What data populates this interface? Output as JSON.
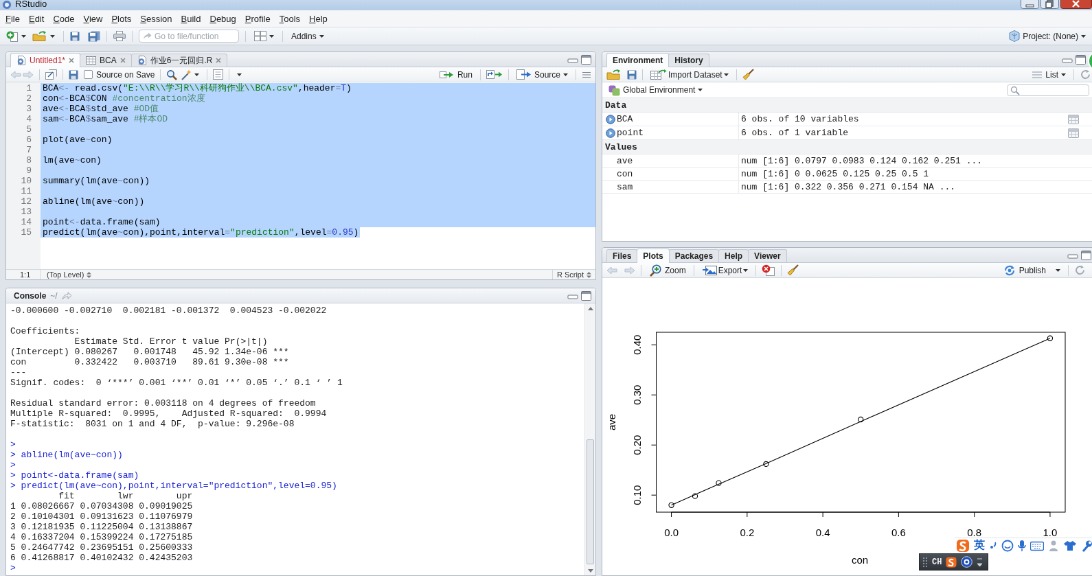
{
  "window": {
    "title": "RStudio"
  },
  "menu": [
    "File",
    "Edit",
    "Code",
    "View",
    "Plots",
    "Session",
    "Build",
    "Debug",
    "Profile",
    "Tools",
    "Help"
  ],
  "toolbar": {
    "goto": {
      "placeholder": "Go to file/function"
    },
    "addins": "Addins",
    "project": "Project: (None)"
  },
  "editor": {
    "tabs": [
      {
        "label": "Untitled1*",
        "kind": "script",
        "selected": true,
        "modified": true
      },
      {
        "label": "BCA",
        "kind": "data",
        "selected": false,
        "modified": false
      },
      {
        "label": "作业6一元回归.R",
        "kind": "script",
        "selected": false,
        "modified": false
      }
    ],
    "source_on_save": {
      "label": "Source on Save",
      "checked": false
    },
    "run": "Run",
    "source": "Source",
    "lines": [
      {
        "number": "1",
        "selected": true,
        "tokens": [
          {
            "text": "BCA",
            "kind": "id"
          },
          {
            "text": "<-",
            "kind": "op"
          },
          {
            "text": " read.csv(",
            "kind": "id"
          },
          {
            "text": "\"E:\\\\R\\\\学习R\\\\科研狗作业\\\\BCA.csv\"",
            "kind": "str"
          },
          {
            "text": ",header",
            "kind": "id"
          },
          {
            "text": "=",
            "kind": "op"
          },
          {
            "text": "T",
            "kind": "num"
          },
          {
            "text": ")",
            "kind": "id"
          }
        ]
      },
      {
        "number": "2",
        "selected": true,
        "tokens": [
          {
            "text": "con",
            "kind": "id"
          },
          {
            "text": "<-",
            "kind": "op"
          },
          {
            "text": "BCA",
            "kind": "id"
          },
          {
            "text": "$",
            "kind": "op"
          },
          {
            "text": "CON ",
            "kind": "id"
          },
          {
            "text": "#concentration浓度",
            "kind": "com"
          }
        ]
      },
      {
        "number": "3",
        "selected": true,
        "tokens": [
          {
            "text": "ave",
            "kind": "id"
          },
          {
            "text": "<-",
            "kind": "op"
          },
          {
            "text": "BCA",
            "kind": "id"
          },
          {
            "text": "$",
            "kind": "op"
          },
          {
            "text": "std_ave ",
            "kind": "id"
          },
          {
            "text": "#OD值",
            "kind": "com"
          }
        ]
      },
      {
        "number": "4",
        "selected": true,
        "tokens": [
          {
            "text": "sam",
            "kind": "id"
          },
          {
            "text": "<-",
            "kind": "op"
          },
          {
            "text": "BCA",
            "kind": "id"
          },
          {
            "text": "$",
            "kind": "op"
          },
          {
            "text": "sam_ave ",
            "kind": "id"
          },
          {
            "text": "#样本OD",
            "kind": "com"
          }
        ]
      },
      {
        "number": "5",
        "selected": true
      },
      {
        "number": "6",
        "selected": true,
        "tokens": [
          {
            "text": "plot(ave",
            "kind": "id"
          },
          {
            "text": "~",
            "kind": "op"
          },
          {
            "text": "con)",
            "kind": "id"
          }
        ]
      },
      {
        "number": "7",
        "selected": true
      },
      {
        "number": "8",
        "selected": true,
        "tokens": [
          {
            "text": "lm(ave",
            "kind": "id"
          },
          {
            "text": "~",
            "kind": "op"
          },
          {
            "text": "con)",
            "kind": "id"
          }
        ]
      },
      {
        "number": "9",
        "selected": true
      },
      {
        "number": "10",
        "selected": true,
        "tokens": [
          {
            "text": "summary(lm(ave",
            "kind": "id"
          },
          {
            "text": "~",
            "kind": "op"
          },
          {
            "text": "con))",
            "kind": "id"
          }
        ]
      },
      {
        "number": "11",
        "selected": true
      },
      {
        "number": "12",
        "selected": true,
        "tokens": [
          {
            "text": "abline(lm(ave",
            "kind": "id"
          },
          {
            "text": "~",
            "kind": "op"
          },
          {
            "text": "con))",
            "kind": "id"
          }
        ]
      },
      {
        "number": "13",
        "selected": true
      },
      {
        "number": "14",
        "selected": true,
        "tokens": [
          {
            "text": "point",
            "kind": "id"
          },
          {
            "text": "<-",
            "kind": "op"
          },
          {
            "text": "data.frame(sam)",
            "kind": "id"
          }
        ]
      },
      {
        "number": "15",
        "selected": true,
        "tokens": [
          {
            "text": "predict(lm(ave",
            "kind": "id"
          },
          {
            "text": "~",
            "kind": "op"
          },
          {
            "text": "con),point,interval",
            "kind": "id"
          },
          {
            "text": "=",
            "kind": "op"
          },
          {
            "text": "\"prediction\"",
            "kind": "str"
          },
          {
            "text": ",level",
            "kind": "id"
          },
          {
            "text": "=",
            "kind": "op"
          },
          {
            "text": "0.95",
            "kind": "num"
          },
          {
            "text": ")",
            "kind": "id"
          }
        ]
      }
    ],
    "status": {
      "position": "1:1",
      "scope": "(Top Level)",
      "file_type": "R Script"
    }
  },
  "console": {
    "title": "Console",
    "path": "~/",
    "lines": [
      {
        "kind": "output",
        "text": "-0.000600 -0.002710  0.002181 -0.001372  0.004523 -0.002022"
      },
      {
        "kind": "blank"
      },
      {
        "kind": "output",
        "text": "Coefficients:"
      },
      {
        "kind": "output",
        "text": "            Estimate Std. Error t value Pr(>|t|)"
      },
      {
        "kind": "output",
        "text": "(Intercept) 0.080267   0.001748   45.92 1.34e-06 ***"
      },
      {
        "kind": "output",
        "text": "con         0.332422   0.003710   89.61 9.30e-08 ***"
      },
      {
        "kind": "output",
        "text": "---"
      },
      {
        "kind": "output",
        "text": "Signif. codes:  0 ‘***’ 0.001 ‘**’ 0.01 ‘*’ 0.05 ‘.’ 0.1 ‘ ’ 1"
      },
      {
        "kind": "blank"
      },
      {
        "kind": "output",
        "text": "Residual standard error: 0.003118 on 4 degrees of freedom"
      },
      {
        "kind": "output",
        "text": "Multiple R-squared:  0.9995,    Adjusted R-squared:  0.9994"
      },
      {
        "kind": "output",
        "text": "F-statistic:  8031 on 1 and 4 DF,  p-value: 9.296e-08"
      },
      {
        "kind": "blank"
      },
      {
        "kind": "input",
        "text": ">"
      },
      {
        "kind": "input",
        "text": "> abline(lm(ave~con))"
      },
      {
        "kind": "input",
        "text": ">"
      },
      {
        "kind": "input",
        "text": "> point<-data.frame(sam)"
      },
      {
        "kind": "input",
        "text": "> predict(lm(ave~con),point,interval=\"prediction\",level=0.95)"
      },
      {
        "kind": "output",
        "text": "         fit        lwr        upr"
      },
      {
        "kind": "output",
        "text": "1 0.08026667 0.07034308 0.09019025"
      },
      {
        "kind": "output",
        "text": "2 0.10104301 0.09131623 0.11076979"
      },
      {
        "kind": "output",
        "text": "3 0.12181935 0.11225004 0.13138867"
      },
      {
        "kind": "output",
        "text": "4 0.16337204 0.15399224 0.17275185"
      },
      {
        "kind": "output",
        "text": "5 0.24647742 0.23695151 0.25600333"
      },
      {
        "kind": "output",
        "text": "6 0.41268817 0.40102432 0.42435203"
      },
      {
        "kind": "input",
        "text": ">"
      }
    ]
  },
  "environment": {
    "tabs": [
      {
        "label": "Environment",
        "selected": true
      },
      {
        "label": "History",
        "selected": false
      }
    ],
    "import": "Import Dataset",
    "view": "List",
    "scope": "Global Environment",
    "sections": [
      {
        "title": "Data",
        "rows": [
          {
            "name": "BCA",
            "value": "6 obs. of 10 variables",
            "kind": "data"
          },
          {
            "name": "point",
            "value": "6 obs. of 1 variable",
            "kind": "data"
          }
        ]
      },
      {
        "title": "Values",
        "rows": [
          {
            "name": "ave",
            "value": "num [1:6] 0.0797 0.0983 0.124 0.162 0.251 ...",
            "kind": "value"
          },
          {
            "name": "con",
            "value": "num [1:6] 0 0.0625 0.125 0.25 0.5 1",
            "kind": "value"
          },
          {
            "name": "sam",
            "value": "num [1:6] 0.322 0.356 0.271 0.154 NA ...",
            "kind": "value"
          }
        ]
      }
    ]
  },
  "files": {
    "tabs": [
      {
        "label": "Files",
        "selected": false
      },
      {
        "label": "Plots",
        "selected": true
      },
      {
        "label": "Packages",
        "selected": false
      },
      {
        "label": "Help",
        "selected": false
      },
      {
        "label": "Viewer",
        "selected": false
      }
    ],
    "zoom": "Zoom",
    "export": "Export",
    "publish": "Publish",
    "chart_data": {
      "type": "scatter",
      "xlabel": "con",
      "ylabel": "ave",
      "x": [
        0,
        0.0625,
        0.125,
        0.25,
        0.5,
        1
      ],
      "series": [
        {
          "color": "#000000",
          "values": [
            0.08,
            0.098,
            0.124,
            0.162,
            0.251,
            0.413
          ]
        },
        {
          "type": "line",
          "color": "#000000",
          "values": [
            0.08,
            0.101,
            0.122,
            0.163,
            0.247,
            0.413
          ]
        }
      ],
      "xlim": [
        -0.04,
        1.04
      ],
      "ylim": [
        0.066,
        0.425
      ],
      "xticks": [
        {
          "value": 0,
          "label": "0.0"
        },
        {
          "value": 0.2,
          "label": "0.2"
        },
        {
          "value": 0.4,
          "label": "0.4"
        },
        {
          "value": 0.6,
          "label": "0.6"
        },
        {
          "value": 0.8,
          "label": "0.8"
        },
        {
          "value": 1,
          "label": "1.0"
        }
      ],
      "yticks": [
        {
          "value": 0.1,
          "label": "0.10"
        },
        {
          "value": 0.2,
          "label": "0.20"
        },
        {
          "value": 0.3,
          "label": "0.30"
        },
        {
          "value": 0.4,
          "label": "0.40"
        }
      ]
    }
  },
  "ime": {
    "mode": "英",
    "language": "CH"
  }
}
